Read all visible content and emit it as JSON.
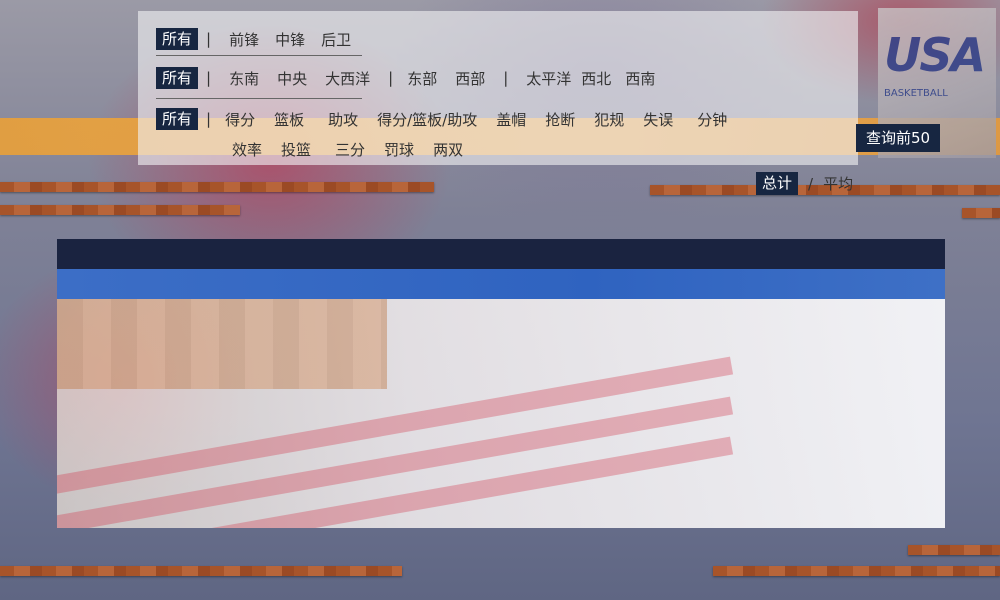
{
  "filters": {
    "position": {
      "all_label": "所有",
      "separator": "|",
      "options": [
        "前锋",
        "中锋",
        "后卫"
      ]
    },
    "division": {
      "all_label": "所有",
      "separator": "|",
      "east_options": [
        "东南",
        "中央",
        "大西洋"
      ],
      "group_separator": "|",
      "conference_options": [
        "东部",
        "西部"
      ],
      "west_options": [
        "太平洋",
        "西北",
        "西南"
      ]
    },
    "stat": {
      "all_label": "所有",
      "separator": "|",
      "row1": [
        "得分",
        "篮板",
        "助攻",
        "得分/篮板/助攻",
        "盖帽",
        "抢断",
        "犯规",
        "失误",
        "分钟"
      ],
      "row2": [
        "效率",
        "投篮",
        "三分",
        "罚球",
        "两双"
      ]
    }
  },
  "query_button": "查询前50",
  "mode_toggle": {
    "active": "总计",
    "slash": "/",
    "other": "平均"
  },
  "colors": {
    "navy": "#172641",
    "header_blue": "#2f63c0",
    "band_orange": "#f0a94a"
  },
  "logo": {
    "text": "USA",
    "subtext": "BASKETBALL"
  }
}
